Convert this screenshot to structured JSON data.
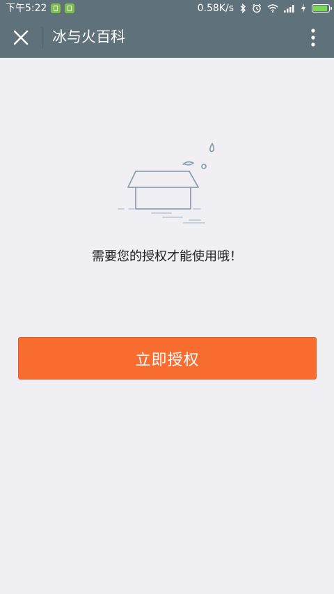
{
  "status_bar": {
    "time": "下午5:22",
    "net_speed": "0.58K/s",
    "battery_level": 0.92,
    "icons": [
      "app-notification-icon",
      "app-notification-icon",
      "bluetooth-icon",
      "alarm-icon",
      "wifi-icon",
      "signal-icon",
      "charging-icon",
      "battery-icon"
    ]
  },
  "title_bar": {
    "title": "冰与火百科",
    "close_icon": "close-icon",
    "more_icon": "more-vertical-icon"
  },
  "main": {
    "illustration": "empty-box-illustration",
    "message": "需要您的授权才能使用哦！",
    "authorize_button": "立即授权"
  },
  "colors": {
    "header": "#5f717a",
    "background": "#efeff4",
    "accent": "#f96c2f",
    "text": "#222222"
  }
}
